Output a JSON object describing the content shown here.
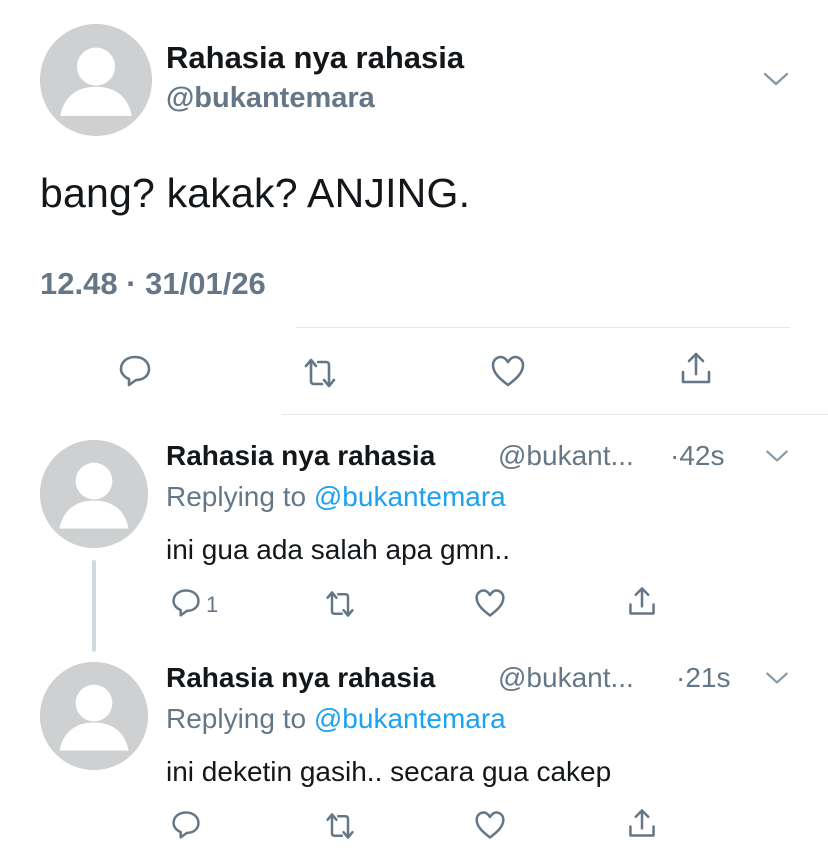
{
  "main_tweet": {
    "author_name": "Rahasia nya rahasia",
    "handle": "@bukantemara",
    "text": "bang? kakak? ANJING.",
    "timestamp": "12.48 · 31/01/26"
  },
  "replies": [
    {
      "author_name": "Rahasia nya rahasia",
      "handle_truncated": "@bukant...",
      "age": "·42s",
      "replying_prefix": "Replying to ",
      "replying_handle": "@bukantemara",
      "text": "ini gua ada salah apa gmn..",
      "reply_count": "1"
    },
    {
      "author_name": "Rahasia nya rahasia",
      "handle_truncated": "@bukant...",
      "age": "·21s",
      "replying_prefix": "Replying to ",
      "replying_handle": "@bukantemara",
      "text": "ini deketin gasih.. secara gua cakep",
      "reply_count": ""
    }
  ],
  "icons": {
    "reply": "reply-icon",
    "retweet": "retweet-icon",
    "like": "heart-icon",
    "share": "share-icon",
    "more": "chevron-down-icon",
    "avatar": "default-avatar"
  },
  "colors": {
    "text": "#14171a",
    "secondary": "#657786",
    "link": "#1da1f2",
    "divider": "#e1e8ed",
    "avatar_bg": "#cfd0d2"
  }
}
